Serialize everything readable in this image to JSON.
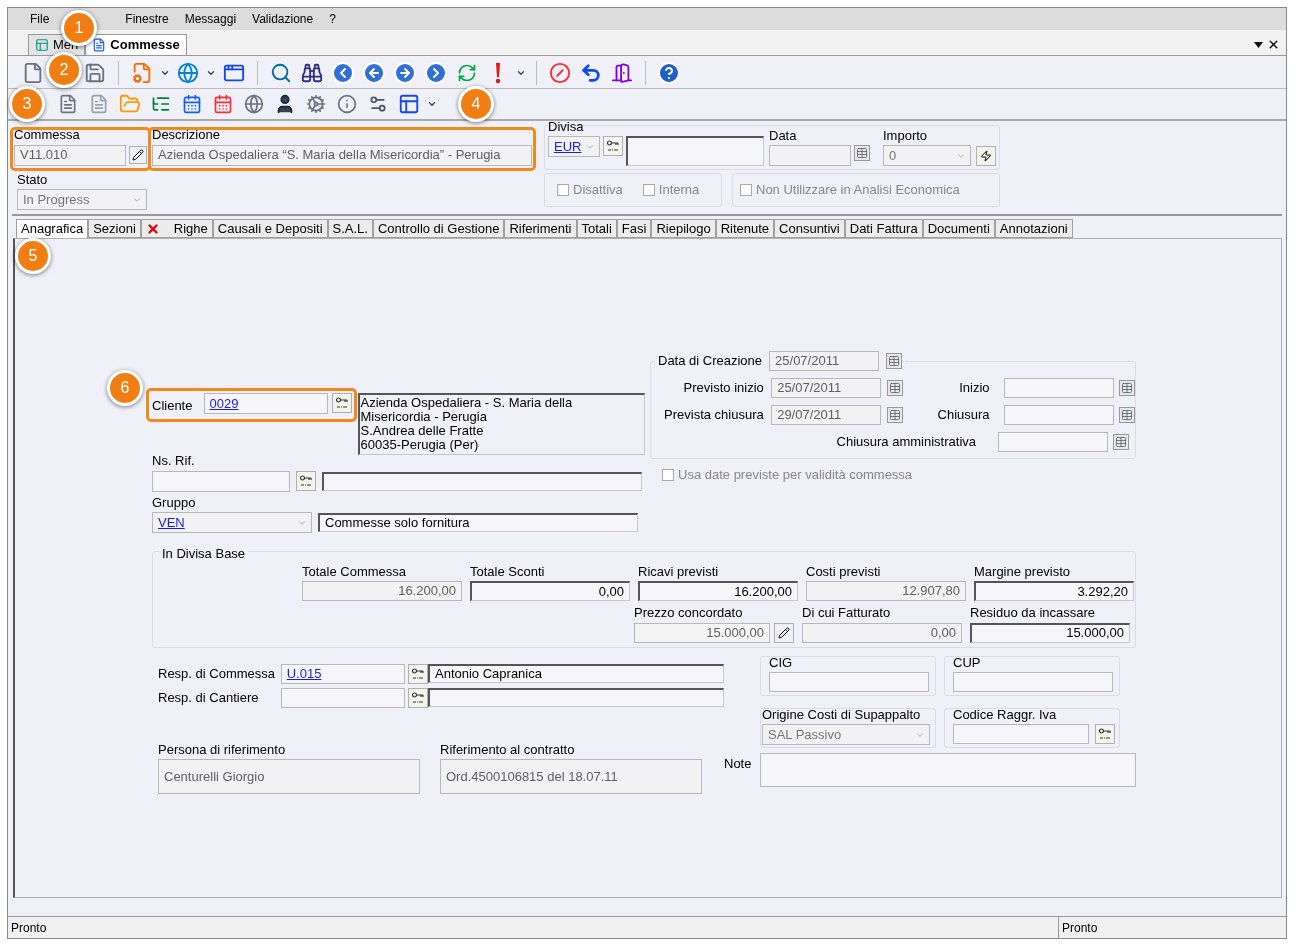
{
  "menu": [
    "File",
    "Finestre",
    "Messaggi",
    "Validazione",
    "?"
  ],
  "doc_tabs": [
    {
      "label": "Men",
      "selected": false
    },
    {
      "label": "Commesse",
      "selected": true
    }
  ],
  "callouts": [
    "1",
    "2",
    "3",
    "4",
    "5",
    "6"
  ],
  "header": {
    "commessa_label": "Commessa",
    "commessa_value": "V11.010",
    "descrizione_label": "Descrizione",
    "descrizione_value": "Azienda Ospedaliera “S. Maria della Misericordia” - Perugia",
    "divisa_label": "Divisa",
    "divisa_value": "EUR",
    "data_label": "Data",
    "importo_label": "Importo",
    "importo_value": "0",
    "stato_label": "Stato",
    "stato_value": "In Progress",
    "checks": [
      {
        "label": "Disattiva",
        "checked": false
      },
      {
        "label": "Interna",
        "checked": false
      },
      {
        "label": "Non Utilizzare in Analisi Economica",
        "checked": false
      }
    ]
  },
  "tabs": [
    {
      "label": "Anagrafica",
      "selected": true
    },
    {
      "label": "Sezioni",
      "selected": false
    },
    {
      "label": "Righe",
      "selected": false,
      "kind": "error"
    },
    {
      "label": "Causali e Depositi",
      "selected": false
    },
    {
      "label": "S.A.L.",
      "selected": false
    },
    {
      "label": "Controllo di Gestione",
      "selected": false
    },
    {
      "label": "Riferimenti",
      "selected": false
    },
    {
      "label": "Totali",
      "selected": false
    },
    {
      "label": "Fasi",
      "selected": false
    },
    {
      "label": "Riepilogo",
      "selected": false
    },
    {
      "label": "Ritenute",
      "selected": false
    },
    {
      "label": "Consuntivi",
      "selected": false
    },
    {
      "label": "Dati Fattura",
      "selected": false
    },
    {
      "label": "Documenti",
      "selected": false
    },
    {
      "label": "Annotazioni",
      "selected": false
    }
  ],
  "cliente": {
    "label": "Cliente",
    "code": "0029",
    "address": [
      "Azienda Ospedaliera - S. Maria della",
      "Misericordia - Perugia",
      "S.Andrea delle Fratte",
      "60035-Perugia (Per)"
    ]
  },
  "ns_rif": {
    "label": "Ns. Rif."
  },
  "gruppo": {
    "label": "Gruppo",
    "code": "VEN",
    "description": "Commesse solo fornitura"
  },
  "dates": {
    "title": "Data di Creazione",
    "value": "25/07/2011",
    "rows": [
      {
        "label": "Previsto inizio",
        "value": "25/07/2011",
        "label2": "Inizio"
      },
      {
        "label": "Prevista chiusura",
        "value": "29/07/2011",
        "label2": "Chiusura"
      }
    ],
    "admin_label": "Chiusura amministrativa"
  },
  "usa_date": {
    "label": "Usa date previste per validità commessa",
    "checked": false
  },
  "divisa_base": {
    "title": "In Divisa Base",
    "row1": [
      {
        "label": "Totale Commessa",
        "value": "16.200,00",
        "kind": "disabled"
      },
      {
        "label": "Totale Sconti",
        "value": "0,00",
        "kind": "sunken"
      },
      {
        "label": "Ricavi previsti",
        "value": "16.200,00",
        "kind": "sunken"
      },
      {
        "label": "Costi previsti",
        "value": "12.907,80",
        "kind": "disabled"
      },
      {
        "label": "Margine previsto",
        "value": "3.292,20",
        "kind": "sunken"
      }
    ],
    "row2": [
      {
        "label": "Prezzo concordato",
        "value": "15.000,00",
        "kind": "editable"
      },
      {
        "label": "Di cui Fatturato",
        "value": "0,00",
        "kind": "disabled"
      },
      {
        "label": "Residuo da incassare",
        "value": "15.000,00",
        "kind": "sunken"
      }
    ]
  },
  "resp": [
    {
      "label": "Resp. di Commessa",
      "code": "U.015",
      "name": "Antonio Capranica"
    },
    {
      "label": "Resp. di Cantiere"
    }
  ],
  "cig": {
    "label": "CIG"
  },
  "cup": {
    "label": "CUP"
  },
  "origine": {
    "label": "Origine Costi di Supappalto",
    "value": "SAL Passivo"
  },
  "codice_raggr": {
    "label": "Codice Raggr. Iva"
  },
  "persona": {
    "label": "Persona di riferimento",
    "value": "Centurelli Giorgio"
  },
  "riferimento": {
    "label": "Riferimento al contratto",
    "value": "Ord.4500106815 del 18.07.11"
  },
  "note": {
    "label": "Note"
  },
  "status_bar": [
    "Pronto",
    "Pronto"
  ]
}
